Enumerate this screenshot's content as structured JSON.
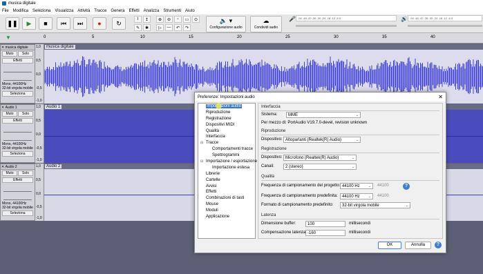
{
  "window": {
    "title": "musica digitale"
  },
  "menu": [
    "File",
    "Modifica",
    "Seleziona",
    "Visualizza",
    "Attività",
    "Tracce",
    "Genera",
    "Effetti",
    "Analizza",
    "Strumenti",
    "Aiuto"
  ],
  "toolbar": {
    "audio_setup_label": "Configurazione audio",
    "share_audio_label": "Condividi audio",
    "meter_ticks": "-54 -48 -42 -36 -30 -24 -18 -12 -6 0"
  },
  "ruler": {
    "ticks": [
      "0",
      "5",
      "10",
      "15",
      "20",
      "25",
      "30",
      "35",
      "40"
    ]
  },
  "tracks": [
    {
      "name": "musica digitale",
      "mute": "Muto",
      "solo": "Solo",
      "effects": "Effetti",
      "format": "Mono, 44100Hz",
      "bits": "32-bit virgola mobile",
      "select": "Seleziona",
      "scale": [
        "1,0",
        "0,5",
        "0,0",
        "-0,5",
        "-1,0"
      ]
    },
    {
      "name": "Audio 1",
      "mute": "Muto",
      "solo": "Solo",
      "effects": "Effetti",
      "format": "Mono, 44100Hz",
      "bits": "32-bit virgola mobile",
      "select": "Seleziona",
      "scale": [
        "1,0",
        "0,5",
        "0,0",
        "-0,5",
        "-1,0"
      ]
    },
    {
      "name": "Audio 2",
      "mute": "Muto",
      "solo": "Solo",
      "effects": "Effetti",
      "format": "Mono, 44100Hz",
      "bits": "32-bit virgola mobile",
      "select": "Seleziona",
      "scale": [
        "1,0",
        "0,5",
        "0,0",
        "-0,5",
        "-1,0"
      ]
    }
  ],
  "dialog": {
    "title": "Preferenze: Impostazioni audio",
    "tree": [
      "Impostazioni audio",
      "Riproduzione",
      "Registrazione",
      "Dispositivi MIDI",
      "Qualità",
      "Interfaccia",
      "Tracce",
      "Comportamenti tracce",
      "Spettrogrammi",
      "Importazione / esportazione",
      "Importazione estesa",
      "Librerie",
      "Cartelle",
      "Avvisi",
      "Effetti",
      "Combinazioni di tasti",
      "Mouse",
      "Moduli",
      "Applicazione"
    ],
    "interface": {
      "section": "Interfaccia",
      "host_label": "Sistema:",
      "host_value": "MME",
      "portaudio": "Per mezzo di: PortAudio V19.7.0-devel, revision unknown"
    },
    "playback": {
      "section": "Riproduzione",
      "device_label": "Dispositivo:",
      "device_value": "Altoparlanti (Realtek(R) Audio)"
    },
    "recording": {
      "section": "Registrazione",
      "device_label": "Dispositivo:",
      "device_value": "Microfono (Realtek(R) Audio)",
      "channels_label": "Canali:",
      "channels_value": "2 (stereo)"
    },
    "quality": {
      "section": "Qualità",
      "project_rate_label": "Frequenza di campionamento del progetto:",
      "project_rate_value": "44100 Hz",
      "project_rate_other": "44100",
      "default_rate_label": "Frequenza di campionamento predefinita:",
      "default_rate_value": "44100 Hz",
      "default_rate_other": "44100",
      "format_label": "Formato di campionamento predefinito:",
      "format_value": "32-bit virgola mobile"
    },
    "latency": {
      "section": "Latenza",
      "buffer_label": "Dimensione buffer:",
      "buffer_value": "100",
      "buffer_unit": "millisecondi",
      "comp_label": "Compensazione latenza:",
      "comp_value": "-160",
      "comp_unit": "millisecondi"
    },
    "ok_label": "OK",
    "cancel_label": "Annulla"
  },
  "colors": {
    "waveform": "#3b3bd6",
    "selection": "#3377dd",
    "track_bg": "#6a6c86"
  }
}
